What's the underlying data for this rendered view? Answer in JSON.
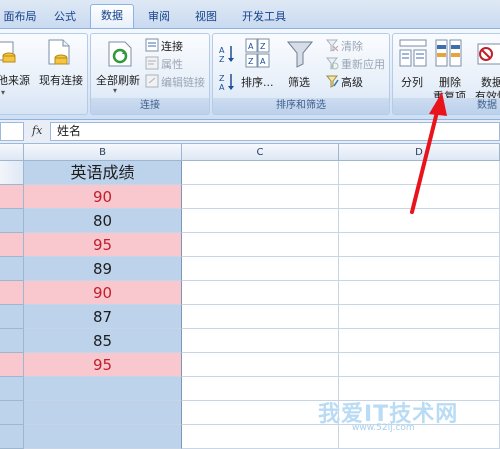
{
  "tabs": [
    {
      "label": "面布局",
      "active": false
    },
    {
      "label": "公式",
      "active": false
    },
    {
      "label": "数据",
      "active": true
    },
    {
      "label": "审阅",
      "active": false
    },
    {
      "label": "视图",
      "active": false
    },
    {
      "label": "开发工具",
      "active": false
    }
  ],
  "ribbon": {
    "get_external": {
      "from_other_sources": "他来源",
      "existing_connections": "现有连接"
    },
    "connections": {
      "refresh_all": "全部刷新",
      "connections": "连接",
      "properties": "属性",
      "edit_links": "编辑链接",
      "group_label": "连接"
    },
    "sort_filter": {
      "sort": "排序...",
      "filter": "筛选",
      "clear": "清除",
      "reapply": "重新应用",
      "advanced": "高级",
      "group_label": "排序和筛选"
    },
    "data_tools": {
      "text_to_columns": "分列",
      "remove_duplicates_line1": "删除",
      "remove_duplicates_line2": "重复项",
      "data_validation_line1": "数据",
      "data_validation_line2": "有效性",
      "group_label": "数据"
    }
  },
  "formula_bar": {
    "fx_label": "fx",
    "value": "姓名"
  },
  "sheet": {
    "columns": [
      "B",
      "C",
      "D"
    ],
    "header_cell": "英语成绩",
    "rows": [
      {
        "value": "90",
        "highlight": "pink"
      },
      {
        "value": "80",
        "highlight": "blue"
      },
      {
        "value": "95",
        "highlight": "pink"
      },
      {
        "value": "89",
        "highlight": "blue"
      },
      {
        "value": "90",
        "highlight": "pink"
      },
      {
        "value": "87",
        "highlight": "blue"
      },
      {
        "value": "85",
        "highlight": "blue"
      },
      {
        "value": "95",
        "highlight": "pink"
      },
      {
        "value": "",
        "highlight": "blue"
      },
      {
        "value": "",
        "highlight": "blue"
      },
      {
        "value": "",
        "highlight": "blue"
      }
    ]
  },
  "watermark": {
    "main": "我爱IT技术网",
    "sub": "www.52ij.com"
  },
  "colors": {
    "annotation_arrow": "#e8131b",
    "highlight_pink": "#f9c8cf",
    "highlight_blue": "#bdd3ec",
    "pink_text": "#c0202a"
  },
  "icons": [
    "get-external-data-icon",
    "existing-connections-icon",
    "refresh-all-icon",
    "connections-icon",
    "properties-icon",
    "edit-links-icon",
    "sort-asc-icon",
    "sort-desc-icon",
    "sort-icon",
    "filter-icon",
    "clear-icon",
    "reapply-icon",
    "advanced-filter-icon",
    "text-to-columns-icon",
    "remove-duplicates-icon",
    "data-validation-icon"
  ]
}
